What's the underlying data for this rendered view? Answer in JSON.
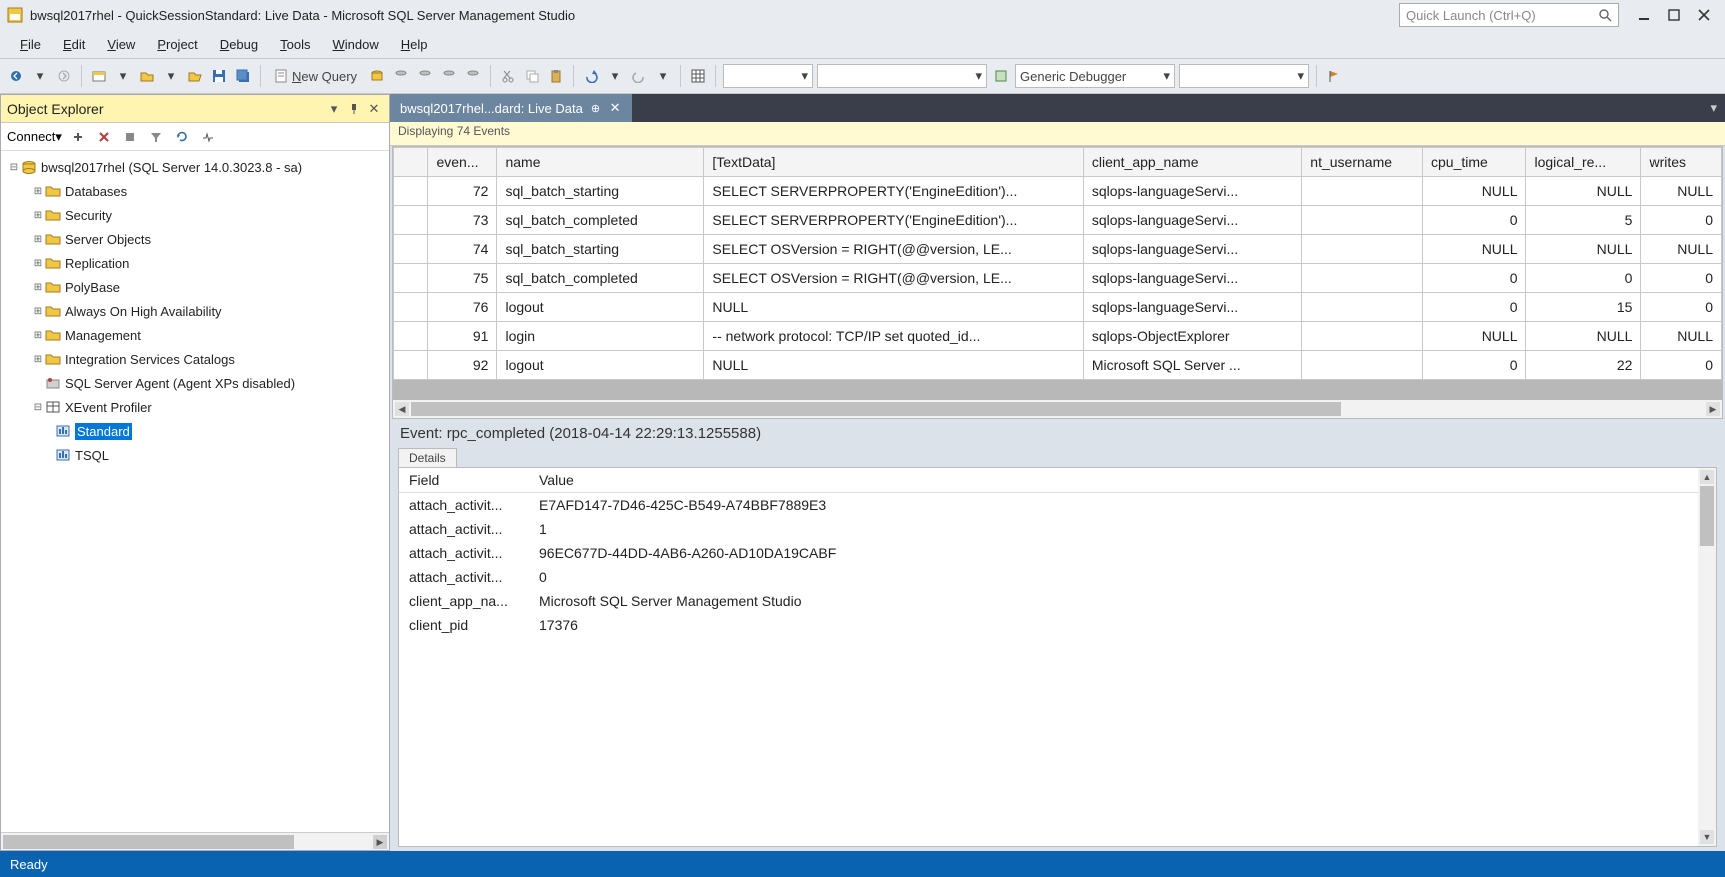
{
  "window": {
    "title": "bwsql2017rhel - QuickSessionStandard: Live Data - Microsoft SQL Server Management Studio",
    "quick_launch_placeholder": "Quick Launch (Ctrl+Q)"
  },
  "menu": {
    "file": "File",
    "edit": "Edit",
    "view": "View",
    "project": "Project",
    "debug": "Debug",
    "tools": "Tools",
    "window": "Window",
    "help": "Help"
  },
  "toolbar": {
    "new_query": "New Query",
    "debugger_combo": "Generic Debugger"
  },
  "object_explorer": {
    "title": "Object Explorer",
    "connect_label": "Connect",
    "root": "bwsql2017rhel (SQL Server 14.0.3023.8 - sa)",
    "nodes": [
      "Databases",
      "Security",
      "Server Objects",
      "Replication",
      "PolyBase",
      "Always On High Availability",
      "Management",
      "Integration Services Catalogs"
    ],
    "agent": "SQL Server Agent (Agent XPs disabled)",
    "xevent": "XEvent Profiler",
    "xevent_children": {
      "standard": "Standard",
      "tsql": "TSQL"
    }
  },
  "live_data": {
    "tab_title": "bwsql2017rhel...dard: Live Data",
    "display_text": "Displaying 74 Events",
    "columns": [
      "",
      "even...",
      "name",
      "[TextData]",
      "client_app_name",
      "nt_username",
      "cpu_time",
      "logical_re...",
      "writes"
    ],
    "rows": [
      {
        "seq": "72",
        "name": "sql_batch_starting",
        "text": "SELECT SERVERPROPERTY('EngineEdition')...",
        "app": "sqlops-languageServi...",
        "user": "",
        "cpu": "NULL",
        "logical": "NULL",
        "writes": "NULL"
      },
      {
        "seq": "73",
        "name": "sql_batch_completed",
        "text": "SELECT SERVERPROPERTY('EngineEdition')...",
        "app": "sqlops-languageServi...",
        "user": "",
        "cpu": "0",
        "logical": "5",
        "writes": "0"
      },
      {
        "seq": "74",
        "name": "sql_batch_starting",
        "text": "SELECT OSVersion = RIGHT(@@version, LE...",
        "app": "sqlops-languageServi...",
        "user": "",
        "cpu": "NULL",
        "logical": "NULL",
        "writes": "NULL"
      },
      {
        "seq": "75",
        "name": "sql_batch_completed",
        "text": "SELECT OSVersion = RIGHT(@@version, LE...",
        "app": "sqlops-languageServi...",
        "user": "",
        "cpu": "0",
        "logical": "0",
        "writes": "0"
      },
      {
        "seq": "76",
        "name": "logout",
        "text": "NULL",
        "app": "sqlops-languageServi...",
        "user": "",
        "cpu": "0",
        "logical": "15",
        "writes": "0"
      },
      {
        "seq": "91",
        "name": "login",
        "text": "-- network protocol: TCP/IP  set quoted_id...",
        "app": "sqlops-ObjectExplorer",
        "user": "",
        "cpu": "NULL",
        "logical": "NULL",
        "writes": "NULL"
      },
      {
        "seq": "92",
        "name": "logout",
        "text": "NULL",
        "app": "Microsoft SQL Server ...",
        "user": "",
        "cpu": "0",
        "logical": "22",
        "writes": "0"
      }
    ],
    "event_detail": "Event: rpc_completed (2018-04-14 22:29:13.1255588)",
    "details_tab": "Details",
    "details_columns": {
      "field": "Field",
      "value": "Value"
    },
    "details": [
      {
        "field": "attach_activit...",
        "value": "E7AFD147-7D46-425C-B549-A74BBF7889E3"
      },
      {
        "field": "attach_activit...",
        "value": "1"
      },
      {
        "field": "attach_activit...",
        "value": "96EC677D-44DD-4AB6-A260-AD10DA19CABF"
      },
      {
        "field": "attach_activit...",
        "value": "0"
      },
      {
        "field": "client_app_na...",
        "value": "Microsoft SQL Server Management Studio"
      },
      {
        "field": "client_pid",
        "value": "17376"
      }
    ]
  },
  "status": {
    "text": "Ready"
  }
}
